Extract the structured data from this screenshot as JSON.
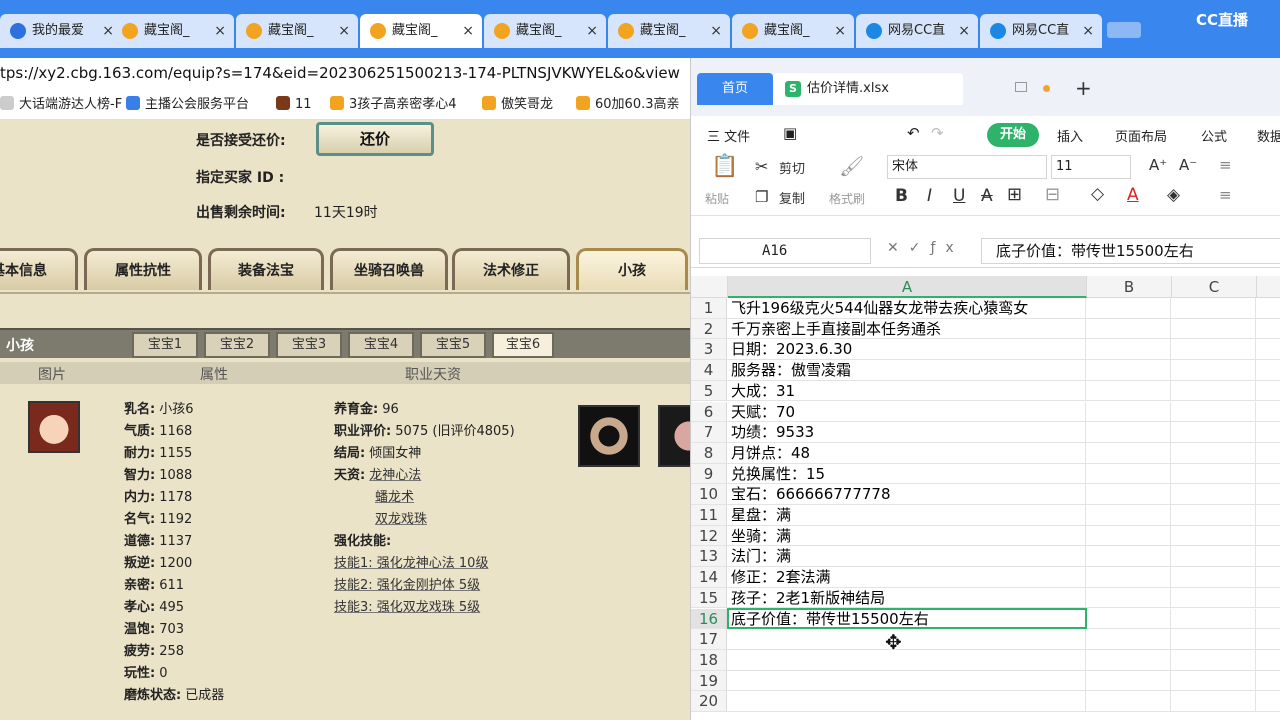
{
  "browser": {
    "tabs": [
      {
        "label": "我的最爱",
        "icon": "s-browser-icon"
      },
      {
        "label": "藏宝阁_",
        "icon": "cbg-icon"
      },
      {
        "label": "藏宝阁_",
        "icon": "cbg-icon"
      },
      {
        "label": "藏宝阁_",
        "icon": "cbg-icon",
        "active": true
      },
      {
        "label": "藏宝阁_",
        "icon": "cbg-icon"
      },
      {
        "label": "藏宝阁_",
        "icon": "cbg-icon"
      },
      {
        "label": "藏宝阁_",
        "icon": "cbg-icon"
      },
      {
        "label": "网易CC直",
        "icon": "cc-icon"
      },
      {
        "label": "网易CC直",
        "icon": "cc-icon"
      }
    ],
    "close_glyph": "×",
    "brand": "CC直播",
    "url": "tps://xy2.cbg.163.com/equip?s=174&eid=202306251500213-174-PLTNSJVKWYEL&o&view",
    "bookmarks": [
      "大话端游达人榜-F",
      "主播公会服务平台",
      "11",
      "3孩子高亲密孝心4",
      "傲笑哥龙",
      "60加60.3高亲"
    ]
  },
  "listing": {
    "accept_counter_label": "是否接受还价:",
    "counter_button": "还价",
    "buyer_id_label": "指定买家 ID :",
    "time_left_label": "出售剩余时间:",
    "time_left_value": "11天19时",
    "big_tabs": [
      "基本信息",
      "属性抗性",
      "装备法宝",
      "坐骑召唤兽",
      "法术修正",
      "小孩"
    ],
    "active_big_tab": "小孩",
    "section_title": "小孩",
    "sub_tabs": [
      "宝宝1",
      "宝宝2",
      "宝宝3",
      "宝宝4",
      "宝宝5",
      "宝宝6"
    ],
    "active_sub_tab": "宝宝6",
    "col_headers": [
      "图片",
      "属性",
      "职业天资"
    ],
    "attributes": [
      {
        "k": "乳名:",
        "v": "小孩6"
      },
      {
        "k": "气质:",
        "v": "1168"
      },
      {
        "k": "耐力:",
        "v": "1155"
      },
      {
        "k": "智力:",
        "v": "1088"
      },
      {
        "k": "内力:",
        "v": "1178"
      },
      {
        "k": "名气:",
        "v": "1192"
      },
      {
        "k": "道德:",
        "v": "1137"
      },
      {
        "k": "叛逆:",
        "v": "1200"
      },
      {
        "k": "亲密:",
        "v": "611"
      },
      {
        "k": "孝心:",
        "v": "495"
      },
      {
        "k": "温饱:",
        "v": "703"
      },
      {
        "k": "疲劳:",
        "v": "258"
      },
      {
        "k": "玩性:",
        "v": "0"
      },
      {
        "k": "磨炼状态:",
        "v": "已成器"
      }
    ],
    "career": {
      "upbringing_label": "养育金:",
      "upbringing_value": "96",
      "rating_label": "职业评价:",
      "rating_value": "5075 (旧评价4805)",
      "ending_label": "结局:",
      "ending_value": "倾国女神",
      "talent_label": "天资:",
      "talents": [
        "龙神心法",
        "蟠龙术",
        "双龙戏珠"
      ],
      "skills_label": "强化技能:",
      "skills": [
        "技能1: 强化龙神心法 10级",
        "技能2: 强化金刚护体 5级",
        "技能3: 强化双龙戏珠 5级"
      ]
    }
  },
  "excel": {
    "home_tab": "首页",
    "file_tab": "估价详情.xlsx",
    "file_icon_letter": "S",
    "new_tab_glyph": "+",
    "menu": [
      "三 文件",
      "开始",
      "插入",
      "页面布局",
      "公式",
      "数据"
    ],
    "ribbon": {
      "paste": "粘贴",
      "cut": "剪切",
      "copy": "复制",
      "format_painter": "格式刷",
      "font_name": "宋体",
      "font_size": "11",
      "bold": "B",
      "italic": "I",
      "underline": "U",
      "strike": "A"
    },
    "name_box": "A16",
    "formula": "底子价值：带传世15500左右",
    "columns": [
      "A",
      "B",
      "C"
    ],
    "selected_row": 16,
    "rows": [
      {
        "n": "1",
        "a": "飞升196级克火544仙器女龙带去疾心猿鸾女"
      },
      {
        "n": "2",
        "a": "千万亲密上手直接副本任务通杀"
      },
      {
        "n": "3",
        "a": "日期：2023.6.30"
      },
      {
        "n": "4",
        "a": "服务器：傲雪凌霜"
      },
      {
        "n": "5",
        "a": "大成：31"
      },
      {
        "n": "6",
        "a": "天赋：70"
      },
      {
        "n": "7",
        "a": "功绩：9533"
      },
      {
        "n": "8",
        "a": "月饼点：48"
      },
      {
        "n": "9",
        "a": "兑换属性：15"
      },
      {
        "n": "10",
        "a": "宝石：666666777778"
      },
      {
        "n": "11",
        "a": "星盘：满"
      },
      {
        "n": "12",
        "a": "坐骑：满"
      },
      {
        "n": "13",
        "a": "法门：满"
      },
      {
        "n": "14",
        "a": "修正：2套法满"
      },
      {
        "n": "15",
        "a": "孩子：2老1新版神结局"
      },
      {
        "n": "16",
        "a": "底子价值：带传世15500左右"
      },
      {
        "n": "17",
        "a": ""
      },
      {
        "n": "18",
        "a": ""
      },
      {
        "n": "19",
        "a": ""
      },
      {
        "n": "20",
        "a": ""
      }
    ]
  }
}
